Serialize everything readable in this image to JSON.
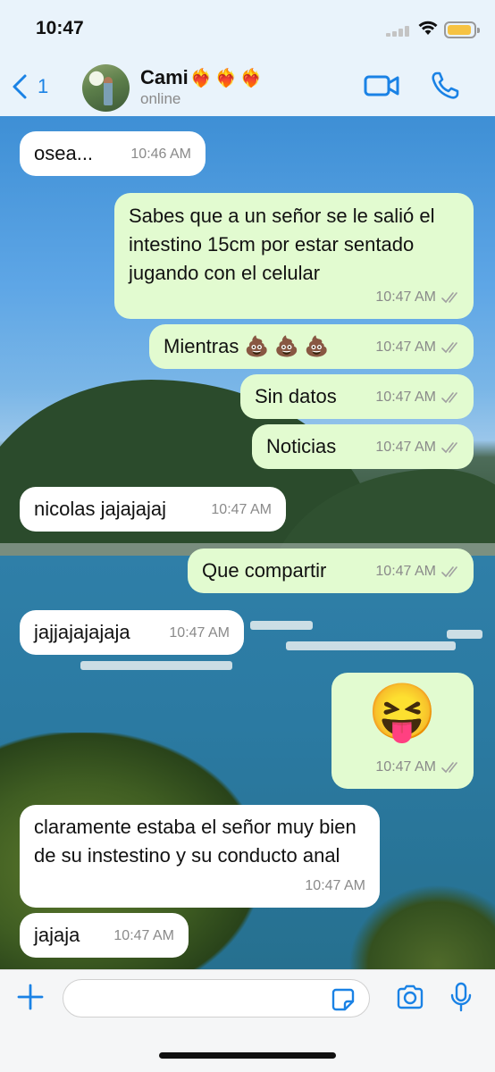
{
  "status_bar": {
    "time": "10:47"
  },
  "header": {
    "back_count": "1",
    "contact_name": "Cami",
    "contact_emojis": "❤️‍🔥❤️‍🔥❤️‍🔥",
    "contact_status": "online"
  },
  "messages": [
    {
      "dir": "in",
      "text": "osea...",
      "time": "10:46 AM"
    },
    {
      "dir": "out",
      "text": "Sabes que a un señor se le salió el intestino 15cm por estar sentado jugando con el celular",
      "time": "10:47 AM"
    },
    {
      "dir": "out",
      "text": "Mientras 💩 💩 💩",
      "time": "10:47 AM"
    },
    {
      "dir": "out",
      "text": "Sin datos",
      "time": "10:47 AM"
    },
    {
      "dir": "out",
      "text": "Noticias",
      "time": "10:47 AM"
    },
    {
      "dir": "in",
      "text": "nicolas jajajajaj",
      "time": "10:47 AM"
    },
    {
      "dir": "out",
      "text": "Que compartir",
      "time": "10:47 AM"
    },
    {
      "dir": "in",
      "text": "jajjajajajaja",
      "time": "10:47 AM"
    },
    {
      "dir": "out",
      "text": "😝",
      "time": "10:47 AM"
    },
    {
      "dir": "in",
      "text": "claramente estaba el señor muy bien de su instestino y su conducto anal",
      "time": "10:47 AM"
    },
    {
      "dir": "in",
      "text": "jajaja",
      "time": "10:47 AM"
    }
  ],
  "composer": {
    "placeholder": ""
  },
  "colors": {
    "accent": "#1a82e5",
    "outgoing_bubble": "#e2fbd0",
    "incoming_bubble": "#ffffff",
    "header_bg": "#e9f3fb"
  },
  "icons": [
    "back-chevron-icon",
    "video-call-icon",
    "phone-icon",
    "plus-icon",
    "sticker-icon",
    "camera-icon",
    "microphone-icon",
    "read-receipt-icon"
  ]
}
